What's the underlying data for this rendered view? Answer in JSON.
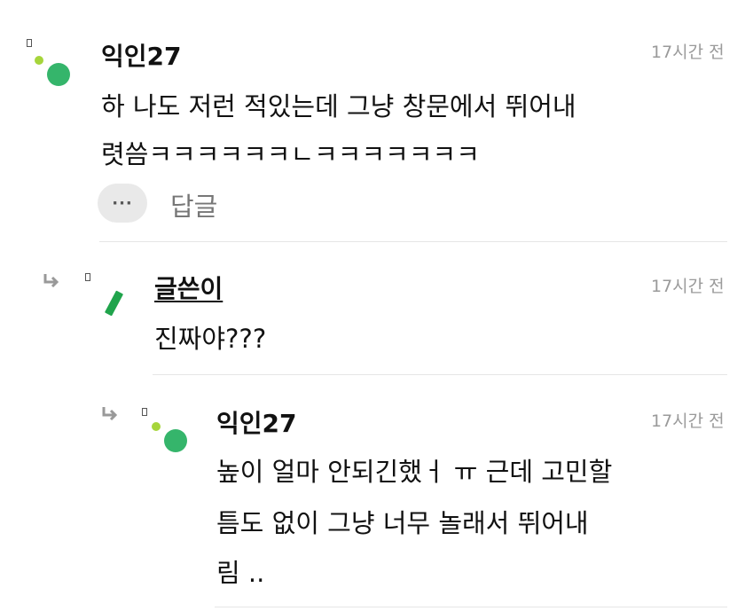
{
  "comments": [
    {
      "author": "익인27",
      "time": "17시간 전",
      "lines": [
        "하 나도 저런 적있는데 그냥 창문에서 뛰어내",
        "렷씀ㅋㅋㅋㅋㅋㅋㄴㅋㅋㅋㅋㅋㅋㅋ"
      ],
      "more_label": "···",
      "reply_label": "답글"
    },
    {
      "author": "글쓴이",
      "time": "17시간 전",
      "lines": [
        "진짜야???"
      ]
    },
    {
      "author": "익인27",
      "time": "17시간 전",
      "lines": [
        "높이 얼마 안되긴했ㅓ ㅠ 근데 고민할",
        "틈도 없이 그냥 너무 놀래서 뛰어내",
        "림 .."
      ]
    }
  ],
  "colors": {
    "avatar_dot_small": "#a6d53b",
    "avatar_dot_big": "#35b56b",
    "author_pen": "#20a44c",
    "time_text": "#9a9a9a"
  },
  "icons": {
    "reply_indicator": "reply-arrow-icon",
    "more": "more-dots-icon"
  }
}
